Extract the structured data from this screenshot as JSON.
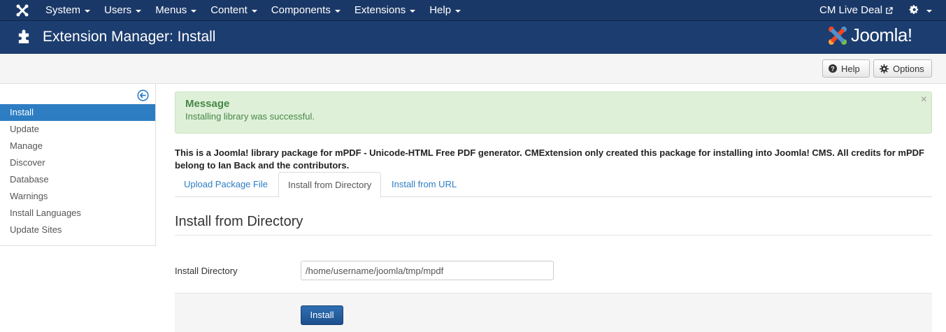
{
  "topnav": {
    "menu": [
      "System",
      "Users",
      "Menus",
      "Content",
      "Components",
      "Extensions",
      "Help"
    ],
    "site_link": "CM Live Deal"
  },
  "header": {
    "title": "Extension Manager: Install",
    "logo_text": "Joomla!"
  },
  "toolbar": {
    "help_label": "Help",
    "options_label": "Options"
  },
  "sidebar": {
    "items": [
      {
        "label": "Install",
        "active": true
      },
      {
        "label": "Update"
      },
      {
        "label": "Manage"
      },
      {
        "label": "Discover"
      },
      {
        "label": "Database"
      },
      {
        "label": "Warnings"
      },
      {
        "label": "Install Languages"
      },
      {
        "label": "Update Sites"
      }
    ]
  },
  "message": {
    "heading": "Message",
    "text": "Installing library was successful.",
    "close": "×"
  },
  "description": "This is a Joomla! library package for mPDF - Unicode-HTML Free PDF generator. CMExtension only created this package for installing into Joomla! CMS. All credits for mPDF belong to Ian Back and the contributors.",
  "tabs": [
    {
      "label": "Upload Package File"
    },
    {
      "label": "Install from Directory",
      "active": true
    },
    {
      "label": "Install from URL"
    }
  ],
  "section": {
    "title": "Install from Directory",
    "dir_label": "Install Directory",
    "dir_value": "/home/username/joomla/tmp/mpdf",
    "install_button": "Install"
  },
  "colors": {
    "nav_bg": "#1a3867",
    "accent": "#2d7dc3",
    "success_bg": "#dff0d8"
  }
}
